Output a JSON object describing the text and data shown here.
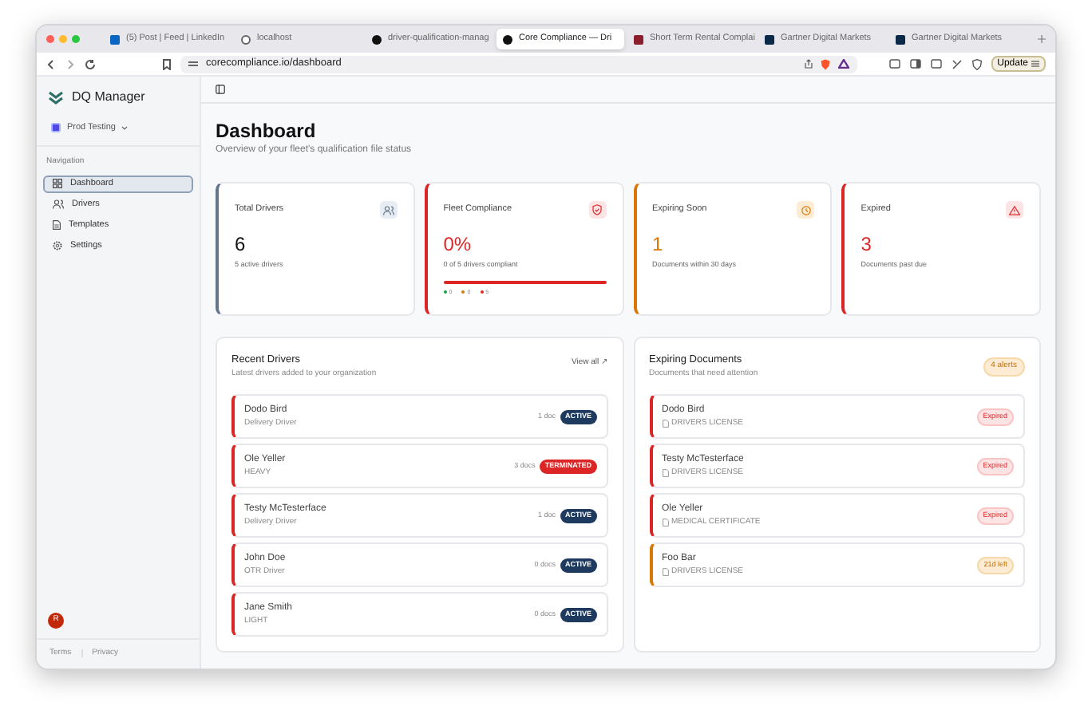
{
  "browser": {
    "tabs": [
      {
        "title": "(5) Post | Feed | LinkedIn",
        "selected": false,
        "kind": "linkedin"
      },
      {
        "title": "localhost",
        "selected": false,
        "kind": "globe"
      },
      {
        "title": "driver-qualification-manag",
        "selected": false,
        "kind": "dark"
      },
      {
        "title": "Core Compliance — Dri",
        "selected": true,
        "kind": "dark"
      },
      {
        "title": "Short Term Rental Complai",
        "selected": false,
        "kind": "rental"
      },
      {
        "title": "Gartner Digital Markets",
        "selected": false,
        "kind": "gartner"
      },
      {
        "title": "Gartner Digital Markets",
        "selected": false,
        "kind": "gartner"
      }
    ],
    "url": "corecompliance.io/dashboard",
    "update_button": "Update"
  },
  "sidebar": {
    "brand": "DQ Manager",
    "org": "Prod Testing",
    "section": "Navigation",
    "items": [
      {
        "label": "Dashboard",
        "selected": true,
        "kind": "grid"
      },
      {
        "label": "Drivers",
        "selected": false,
        "kind": "users"
      },
      {
        "label": "Templates",
        "selected": false,
        "kind": "file"
      },
      {
        "label": "Settings",
        "selected": false,
        "kind": "gear"
      }
    ],
    "avatar": "R",
    "footer_links": [
      "Terms",
      "Privacy"
    ]
  },
  "header": {
    "title": "Dashboard",
    "subtitle": "Overview of your fleet's qualification file status"
  },
  "stats": [
    {
      "label": "Total Drivers",
      "value": "6",
      "caption": "5 active drivers",
      "color": "#64748b",
      "kind": "users"
    },
    {
      "label": "Fleet Compliance",
      "value": "0%",
      "caption": "0 of 5 drivers compliant",
      "color": "#dc2626",
      "kind": "shield",
      "level": 0,
      "breakdown": [
        {
          "count": "0",
          "color": "#16a34a"
        },
        {
          "count": "0",
          "color": "#d97706"
        },
        {
          "count": "5",
          "color": "#dc2626"
        }
      ]
    },
    {
      "label": "Expiring Soon",
      "value": "1",
      "caption": "Documents within 30 days",
      "color": "#d97706",
      "kind": "clock"
    },
    {
      "label": "Expired",
      "value": "3",
      "caption": "Documents past due",
      "color": "#dc2626",
      "kind": "alert"
    }
  ],
  "recent_drivers": {
    "title": "Recent Drivers",
    "subtitle": "Latest drivers added to your organization",
    "link": "View all ↗",
    "rows": [
      {
        "name": "Dodo Bird",
        "role": "Delivery Driver",
        "docs": "1 doc",
        "status": "ACTIVE",
        "kind": "active"
      },
      {
        "name": "Ole Yeller",
        "role": "HEAVY",
        "docs": "3 docs",
        "status": "TERMINATED",
        "kind": "terminated"
      },
      {
        "name": "Testy McTesterface",
        "role": "Delivery Driver",
        "docs": "1 doc",
        "status": "ACTIVE",
        "kind": "active"
      },
      {
        "name": "John Doe",
        "role": "OTR Driver",
        "docs": "0 docs",
        "status": "ACTIVE",
        "kind": "active"
      },
      {
        "name": "Jane Smith",
        "role": "LIGHT",
        "docs": "0 docs",
        "status": "ACTIVE",
        "kind": "active"
      }
    ]
  },
  "expiring_documents": {
    "title": "Expiring Documents",
    "subtitle": "Documents that need attention",
    "badge": "4 alerts",
    "rows": [
      {
        "name": "Dodo Bird",
        "document": "DRIVERS LICENSE",
        "status": "Expired",
        "kind": "expired"
      },
      {
        "name": "Testy McTesterface",
        "document": "DRIVERS LICENSE",
        "status": "Expired",
        "kind": "expired"
      },
      {
        "name": "Ole Yeller",
        "document": "MEDICAL CERTIFICATE",
        "status": "Expired",
        "kind": "expired"
      },
      {
        "name": "Foo Bar",
        "document": "DRIVERS LICENSE",
        "status": "21d left",
        "kind": "expiring"
      }
    ]
  }
}
